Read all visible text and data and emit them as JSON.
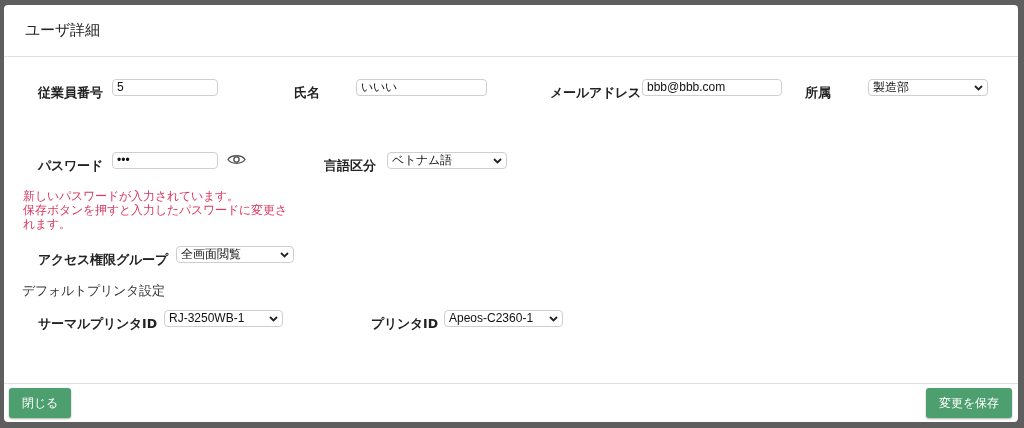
{
  "dialog": {
    "title": "ユーザ詳細"
  },
  "rows": [
    [
      {
        "label": "従業員番号",
        "kind": "text",
        "value": "5"
      },
      {
        "label": "氏名",
        "kind": "text",
        "value": "いいい"
      },
      {
        "label": "メールアドレス",
        "kind": "text",
        "value": "bbb@bbb.com"
      },
      {
        "label": "所属",
        "kind": "select",
        "value": "製造部"
      }
    ],
    [
      {
        "label": "パスワード",
        "kind": "password",
        "value": "•••"
      },
      {
        "label": "言語区分",
        "kind": "select",
        "value": "ベトナム語"
      }
    ]
  ],
  "password_notice": [
    "新しいパスワードが入力されています。",
    "保存ボタンを押すと入力したパスワードに変更されます。"
  ],
  "access_group": {
    "label": "アクセス権限グループ",
    "kind": "select",
    "value": "全画面閲覧"
  },
  "printer_section": {
    "heading": "デフォルトプリンタ設定",
    "fields": [
      {
        "label": "サーマルプリンタID",
        "kind": "select",
        "value": "RJ-3250WB-1"
      },
      {
        "label": "プリンタID",
        "kind": "select",
        "value": "Apeos-C2360-1"
      }
    ]
  },
  "buttons": [
    {
      "label": "閉じる"
    },
    {
      "label": "変更を保存"
    }
  ]
}
